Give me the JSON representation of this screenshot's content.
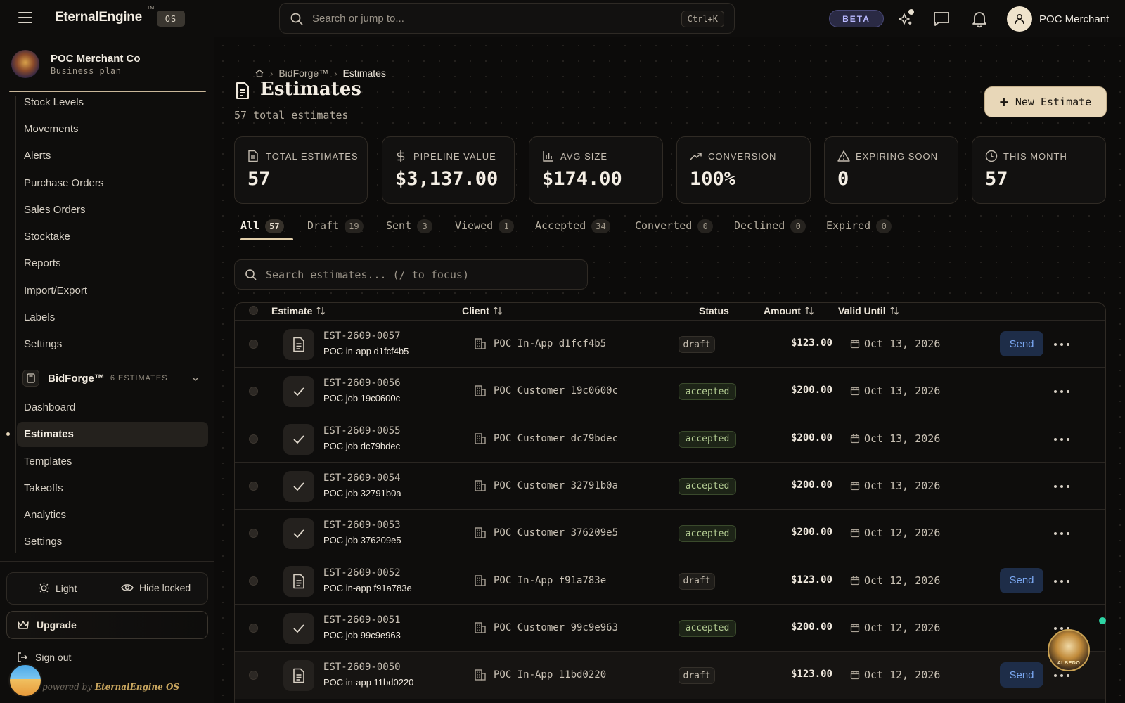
{
  "topbar": {
    "brand": "EternalEngine",
    "tm": "TM",
    "os_badge": "OS",
    "search_placeholder": "Search or jump to...",
    "search_shortcut": "Ctrl+K",
    "beta_label": "BETA",
    "user_name": "POC Merchant"
  },
  "sidebar": {
    "org_name": "POC Merchant Co",
    "org_plan": "Business plan",
    "inventory_items": [
      "Stock Levels",
      "Movements",
      "Alerts",
      "Purchase Orders",
      "Sales Orders",
      "Stocktake",
      "Reports",
      "Import/Export",
      "Labels",
      "Settings"
    ],
    "bidforge_title": "BidForge™",
    "bidforge_count": "6 ESTIMATES",
    "bidforge_items": [
      "Dashboard",
      "Estimates",
      "Templates",
      "Takeoffs",
      "Analytics",
      "Settings"
    ],
    "active_item": "Estimates",
    "theme_light": "Light",
    "hide_locked": "Hide locked",
    "upgrade": "Upgrade",
    "sign_out": "Sign out",
    "powered_prefix": "powered by",
    "powered_brand": "EternalEngine OS"
  },
  "page": {
    "breadcrumb": [
      "BidForge™",
      "Estimates"
    ],
    "title": "Estimates",
    "total_text": "57 total estimates",
    "new_button": "New Estimate"
  },
  "stats": [
    {
      "label": "TOTAL ESTIMATES",
      "value": "57",
      "icon": "document-icon"
    },
    {
      "label": "PIPELINE VALUE",
      "value": "$3,137.00",
      "icon": "dollar-icon"
    },
    {
      "label": "AVG SIZE",
      "value": "$174.00",
      "icon": "bar-chart-icon"
    },
    {
      "label": "CONVERSION",
      "value": "100%",
      "icon": "trend-up-icon"
    },
    {
      "label": "EXPIRING SOON",
      "value": "0",
      "icon": "warning-icon"
    },
    {
      "label": "THIS MONTH",
      "value": "57",
      "icon": "clock-icon"
    }
  ],
  "tabs": [
    {
      "label": "All",
      "count": "57"
    },
    {
      "label": "Draft",
      "count": "19"
    },
    {
      "label": "Sent",
      "count": "3"
    },
    {
      "label": "Viewed",
      "count": "1"
    },
    {
      "label": "Accepted",
      "count": "34"
    },
    {
      "label": "Converted",
      "count": "0"
    },
    {
      "label": "Declined",
      "count": "0"
    },
    {
      "label": "Expired",
      "count": "0"
    }
  ],
  "estimate_search_placeholder": "Search estimates... (/ to focus)",
  "table": {
    "headers": {
      "estimate": "Estimate",
      "client": "Client",
      "status": "Status",
      "amount": "Amount",
      "valid_until": "Valid Until"
    },
    "send_label": "Send",
    "rows": [
      {
        "id": "EST-2609-0057",
        "job": "POC in-app d1fcf4b5",
        "client": "POC In-App d1fcf4b5",
        "status": "draft",
        "amount": "$123.00",
        "valid": "Oct 13, 2026"
      },
      {
        "id": "EST-2609-0056",
        "job": "POC job 19c0600c",
        "client": "POC Customer 19c0600c",
        "status": "accepted",
        "amount": "$200.00",
        "valid": "Oct 13, 2026"
      },
      {
        "id": "EST-2609-0055",
        "job": "POC job dc79bdec",
        "client": "POC Customer dc79bdec",
        "status": "accepted",
        "amount": "$200.00",
        "valid": "Oct 13, 2026"
      },
      {
        "id": "EST-2609-0054",
        "job": "POC job 32791b0a",
        "client": "POC Customer 32791b0a",
        "status": "accepted",
        "amount": "$200.00",
        "valid": "Oct 13, 2026"
      },
      {
        "id": "EST-2609-0053",
        "job": "POC job 376209e5",
        "client": "POC Customer 376209e5",
        "status": "accepted",
        "amount": "$200.00",
        "valid": "Oct 12, 2026"
      },
      {
        "id": "EST-2609-0052",
        "job": "POC in-app f91a783e",
        "client": "POC In-App f91a783e",
        "status": "draft",
        "amount": "$123.00",
        "valid": "Oct 12, 2026"
      },
      {
        "id": "EST-2609-0051",
        "job": "POC job 99c9e963",
        "client": "POC Customer 99c9e963",
        "status": "accepted",
        "amount": "$200.00",
        "valid": "Oct 12, 2026"
      },
      {
        "id": "EST-2609-0050",
        "job": "POC in-app 11bd0220",
        "client": "POC In-App 11bd0220",
        "status": "draft",
        "amount": "$123.00",
        "valid": "Oct 12, 2026"
      }
    ]
  },
  "assistant_label": "ALBEDO",
  "colors": {
    "accent": "#e8d7b8",
    "background": "#0c0b0a",
    "send": "#7aa7f0",
    "accepted": "#b6cf95"
  }
}
